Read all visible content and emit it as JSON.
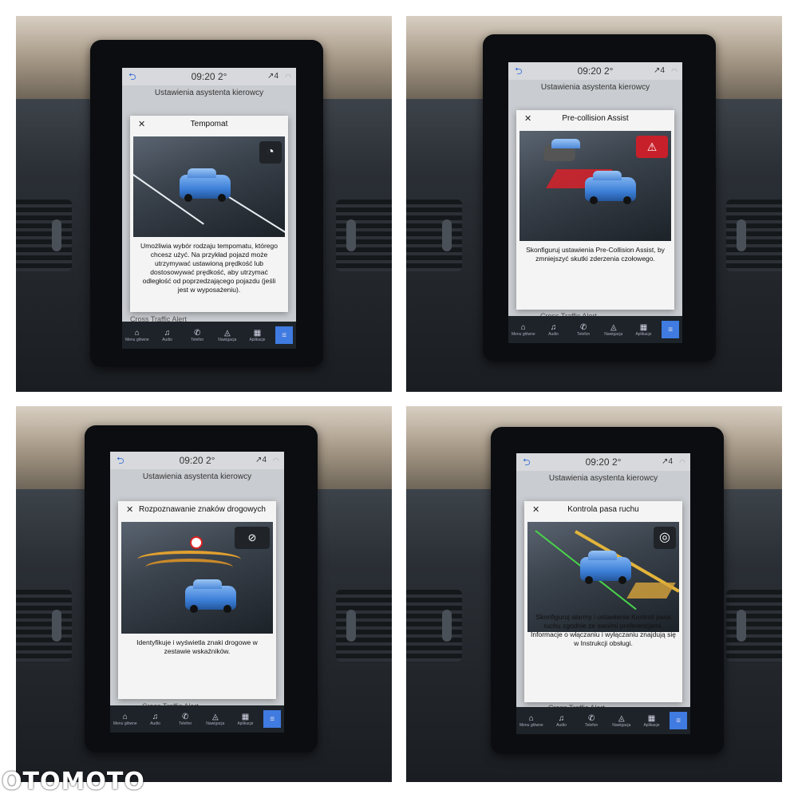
{
  "panels": [
    {
      "time": "09:20",
      "temp": "2°",
      "signal": "4",
      "subtitle": "Ustawienia asystenta kierowcy",
      "bg_item": "Cross Traffic Alert",
      "modal": {
        "title": "Tempomat",
        "icon": "speedometer-icon",
        "text": "Umożliwia wybór rodzaju tempomatu, którego chcesz użyć. Na przykład pojazd może utrzymywać ustawioną prędkość lub dostosowywać prędkość, aby utrzymać odległość od poprzedzającego pojazdu (jeśli jest w wyposażeniu)."
      }
    },
    {
      "time": "09:20",
      "temp": "2°",
      "signal": "4",
      "subtitle": "Ustawienia asystenta kierowcy",
      "bg_item": "Cross Traffic Alert",
      "modal": {
        "title": "Pre-collision Assist",
        "icon": "collision-warning-icon",
        "text": "Skonfiguruj ustawienia Pre-Collision Assist, by zmniejszyć skutki zderzenia czołowego."
      }
    },
    {
      "time": "09:20",
      "temp": "2°",
      "signal": "4",
      "subtitle": "Ustawienia asystenta kierowcy",
      "bg_item": "Cross Traffic Alert",
      "modal": {
        "title": "Rozpoznawanie znaków drogowych",
        "icon": "speed-sign-icon",
        "text": "Identyfikuje i wyświetla znaki drogowe w zestawie wskaźników."
      }
    },
    {
      "time": "09:20",
      "temp": "2°",
      "signal": "4",
      "subtitle": "Ustawienia asystenta kierowcy",
      "bg_item": "Cross Traffic Alert",
      "modal": {
        "title": "Kontrola pasa ruchu",
        "icon": "lane-keeping-icon",
        "text": "Skonfiguruj alarmy i ustawienia Kontroli pasa ruchu zgodnie ze swoimi preferencjami. Informacje o włączaniu i wyłączaniu znajdują się w Instrukcji obsługi."
      }
    }
  ],
  "nav": {
    "home": "Menu główne",
    "audio": "Audio",
    "phone": "Telefon",
    "nav": "Nawigacja",
    "apps": "Aplikacje"
  },
  "watermark": "OTOMOTO"
}
